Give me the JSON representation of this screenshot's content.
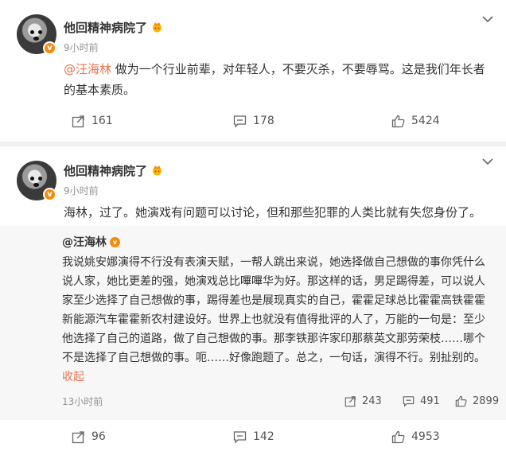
{
  "posts": [
    {
      "username": "他回精神病院了",
      "vip_badge": "v",
      "time": "9小时前",
      "mention": "@汪海林",
      "text": " 做为一个行业前辈，对年轻人，不要灭杀，不要辱骂。这是我们年长者的基本素质。",
      "reposts": "161",
      "comments": "178",
      "likes": "5424"
    },
    {
      "username": "他回精神病院了",
      "vip_badge": "v",
      "time": "9小时前",
      "text": "海林，过了。她演戏有问题可以讨论，但和那些犯罪的人类比就有失您身份了。",
      "reposts": "96",
      "comments": "142",
      "likes": "4953",
      "retweet": {
        "author": "@汪海林",
        "badge": "v",
        "text": "我说姚安娜演得不行没有表演天赋，一帮人跳出来说，她选择做自己想做的事你凭什么说人家，她比更差的强，她演戏总比嗶嗶华为好。那这样的话，男足踢得差，可以说人家至少选择了自己想做的事，踢得差也是展现真实的自己，霍霍足球总比霍霍高铁霍霍新能源汽车霍霍新农村建设好。世界上也就没有值得批评的人了，万能的一句是：至少他选择了自己的道路，做了自己想做的事。那李铁那许家印那蔡英文那劳荣枝……哪个不是选择了自己想做的事。呃……好像跑题了。总之，一句话，演得不行。别扯别的。",
        "fold": "收起",
        "time": "13小时前",
        "reposts": "243",
        "comments": "491",
        "likes": "2899"
      }
    }
  ],
  "colors": {
    "accent": "#eb7350",
    "badge": "#f78b0d"
  }
}
